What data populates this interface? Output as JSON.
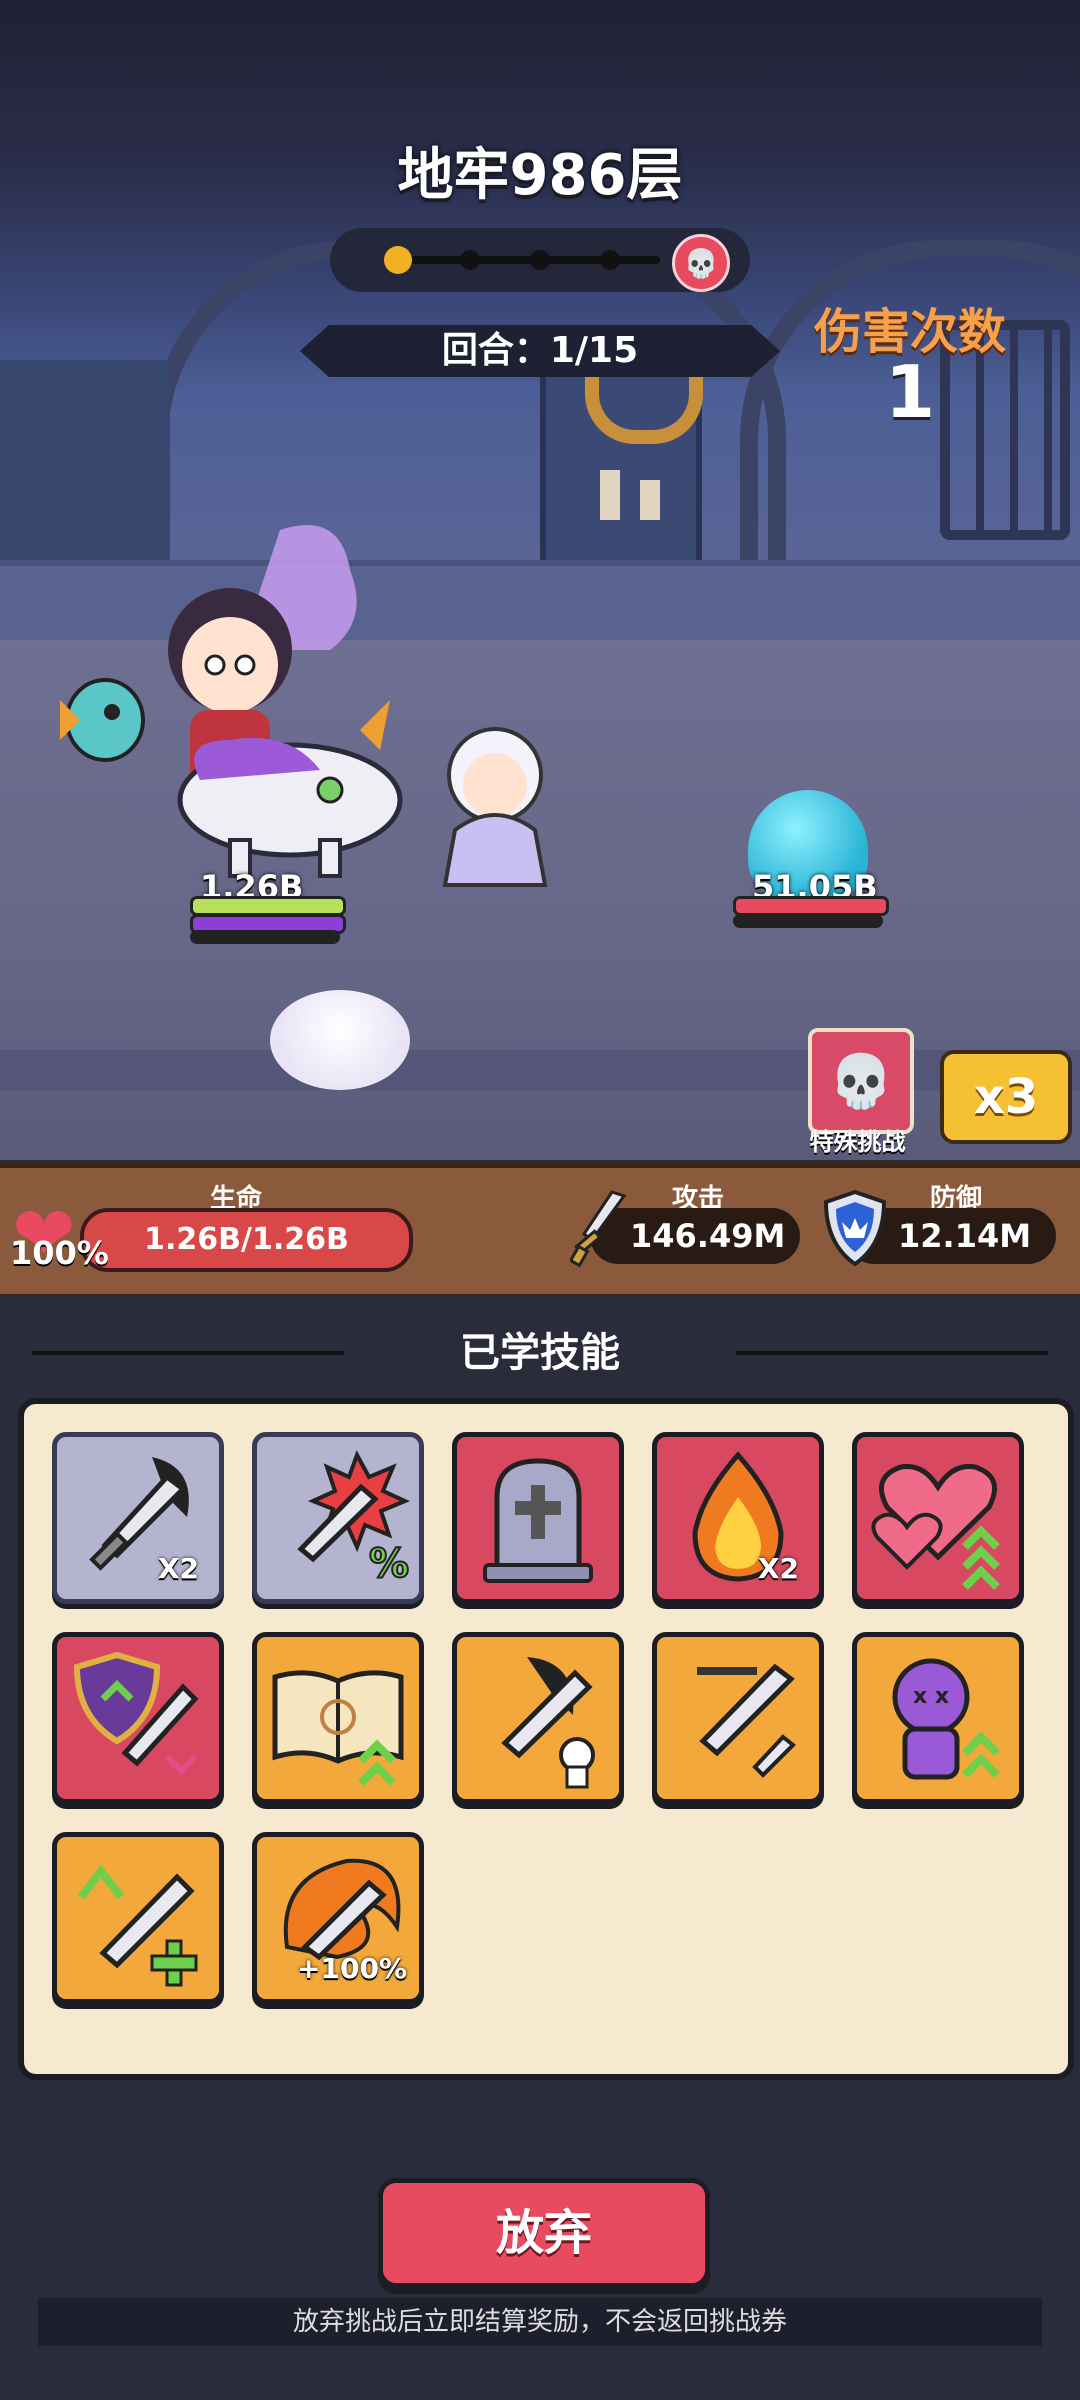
{
  "header": {
    "title": "地牢986层",
    "round": "回合：1/15",
    "damage_label": "伤害次数",
    "damage_count": "1"
  },
  "battle": {
    "hero_hp": "1.26B",
    "enemy_hp": "51.05B",
    "special_label": "特殊挑战",
    "speed": "x3"
  },
  "stats": {
    "life_label": "生命",
    "life_value": "1.26B/1.26B",
    "life_percent": "100%",
    "attack_label": "攻击",
    "attack_value": "146.49M",
    "defense_label": "防御",
    "defense_value": "12.14M"
  },
  "skills": {
    "title": "已学技能",
    "items": [
      {
        "icon": "sword-x2-icon",
        "badge": "X2",
        "color": "gray"
      },
      {
        "icon": "sword-crit-icon",
        "badge": "%",
        "color": "gray"
      },
      {
        "icon": "tombstone-icon",
        "badge": "",
        "color": "red"
      },
      {
        "icon": "fire-icon",
        "badge": "X2",
        "color": "red"
      },
      {
        "icon": "hearts-up-icon",
        "badge": "",
        "color": "red"
      },
      {
        "icon": "shield-sword-icon",
        "badge": "",
        "color": "red"
      },
      {
        "icon": "spellbook-up-icon",
        "badge": "",
        "color": "gold"
      },
      {
        "icon": "sword-skull-icon",
        "badge": "",
        "color": "gold"
      },
      {
        "icon": "sword-dash-icon",
        "badge": "",
        "color": "gold"
      },
      {
        "icon": "voodoo-up-icon",
        "badge": "",
        "color": "gold"
      },
      {
        "icon": "sword-heal-icon",
        "badge": "",
        "color": "gold"
      },
      {
        "icon": "sword-fire-icon",
        "badge": "+100%",
        "color": "gold"
      }
    ]
  },
  "footer": {
    "quit_label": "放弃",
    "note": "放弃挑战后立即结算奖励，不会返回挑战券"
  }
}
